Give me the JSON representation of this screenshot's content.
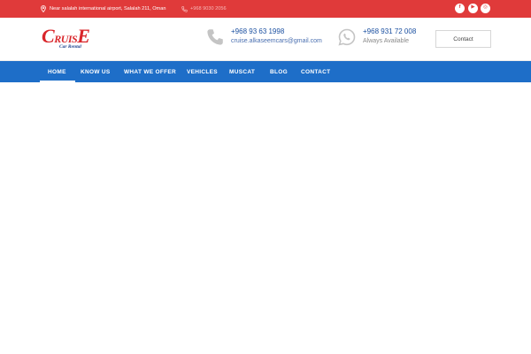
{
  "topbar": {
    "address": "Near salalah international airport, Salalah 211, Oman",
    "phone": "+968 9030 2056",
    "social": [
      {
        "icon": "facebook-icon",
        "glyph": "f"
      },
      {
        "icon": "youtube-icon",
        "glyph": "▶"
      },
      {
        "icon": "instagram-icon",
        "glyph": "◎"
      }
    ]
  },
  "header": {
    "logo": {
      "text_big1": "C",
      "text_small": "RUIS",
      "text_big2": "E",
      "subtitle": "Car Rental"
    },
    "phone_block": {
      "icon": "phone-icon",
      "line1": "+968 93 63 1998",
      "line2": "cruise.alkaseemcars@gmail.com"
    },
    "whatsapp_block": {
      "icon": "whatsapp-icon",
      "line1": "+968 931 72 008",
      "line2": "Always Available"
    },
    "contact_button": "Contact"
  },
  "nav": {
    "items": [
      {
        "label": "HOME",
        "active": true
      },
      {
        "label": "KNOW US"
      },
      {
        "label": "WHAT WE OFFER"
      },
      {
        "label": "VEHICLES"
      },
      {
        "label": "MUSCAT"
      },
      {
        "label": "BLOG"
      },
      {
        "label": "CONTACT"
      }
    ]
  },
  "colors": {
    "topbar": "#e03a3a",
    "nav": "#1e6ec8",
    "brand_red": "#d9252a",
    "brand_blue": "#1a4fa0"
  }
}
